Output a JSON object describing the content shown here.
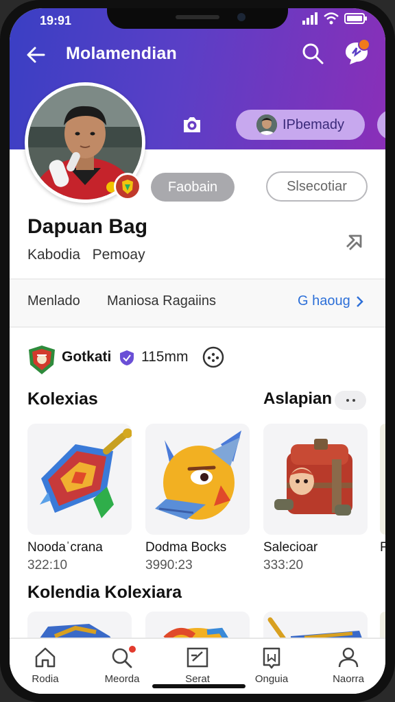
{
  "status": {
    "time": "19:91"
  },
  "appbar": {
    "title": "Molamendian"
  },
  "header": {
    "chip_label": "IPbemady"
  },
  "profile": {
    "primary_button": "Faobain",
    "secondary_button": "Slsecotiar",
    "name": "Dapuan Bag",
    "subtitle": "Kabodia   Pemoay"
  },
  "stats": {
    "item1": "Menlado",
    "item2": "Maniosa  Ragaiins",
    "link": "G haoug"
  },
  "club": {
    "name": "Gotkati",
    "count": "115mm"
  },
  "sections": {
    "collections": {
      "title": "Kolexias",
      "action": "Aslapian"
    },
    "second": {
      "title": "Kolendia Kolexiara"
    }
  },
  "cards": [
    {
      "title": "Noodaˈcrana",
      "number": "322:10",
      "icon": "shield-sword-item"
    },
    {
      "title": "Dodma Bocks",
      "number": "3990:23",
      "icon": "dragon-head-item"
    },
    {
      "title": "Salecioar",
      "number": "333:20",
      "icon": "treasure-chest-item"
    }
  ],
  "card_edge_label": "F",
  "nav": [
    {
      "label": "Rodia",
      "icon": "home-icon"
    },
    {
      "label": "Meorda",
      "icon": "search-icon"
    },
    {
      "label": "Serat",
      "icon": "edit-icon"
    },
    {
      "label": "Onguia",
      "icon": "bookmark-icon"
    },
    {
      "label": "Naorra",
      "icon": "profile-icon"
    }
  ],
  "colors": {
    "header_start": "#3a3fc4",
    "header_end": "#8a2fb8",
    "link": "#2c6fd8",
    "notification": "#f07a1a"
  }
}
